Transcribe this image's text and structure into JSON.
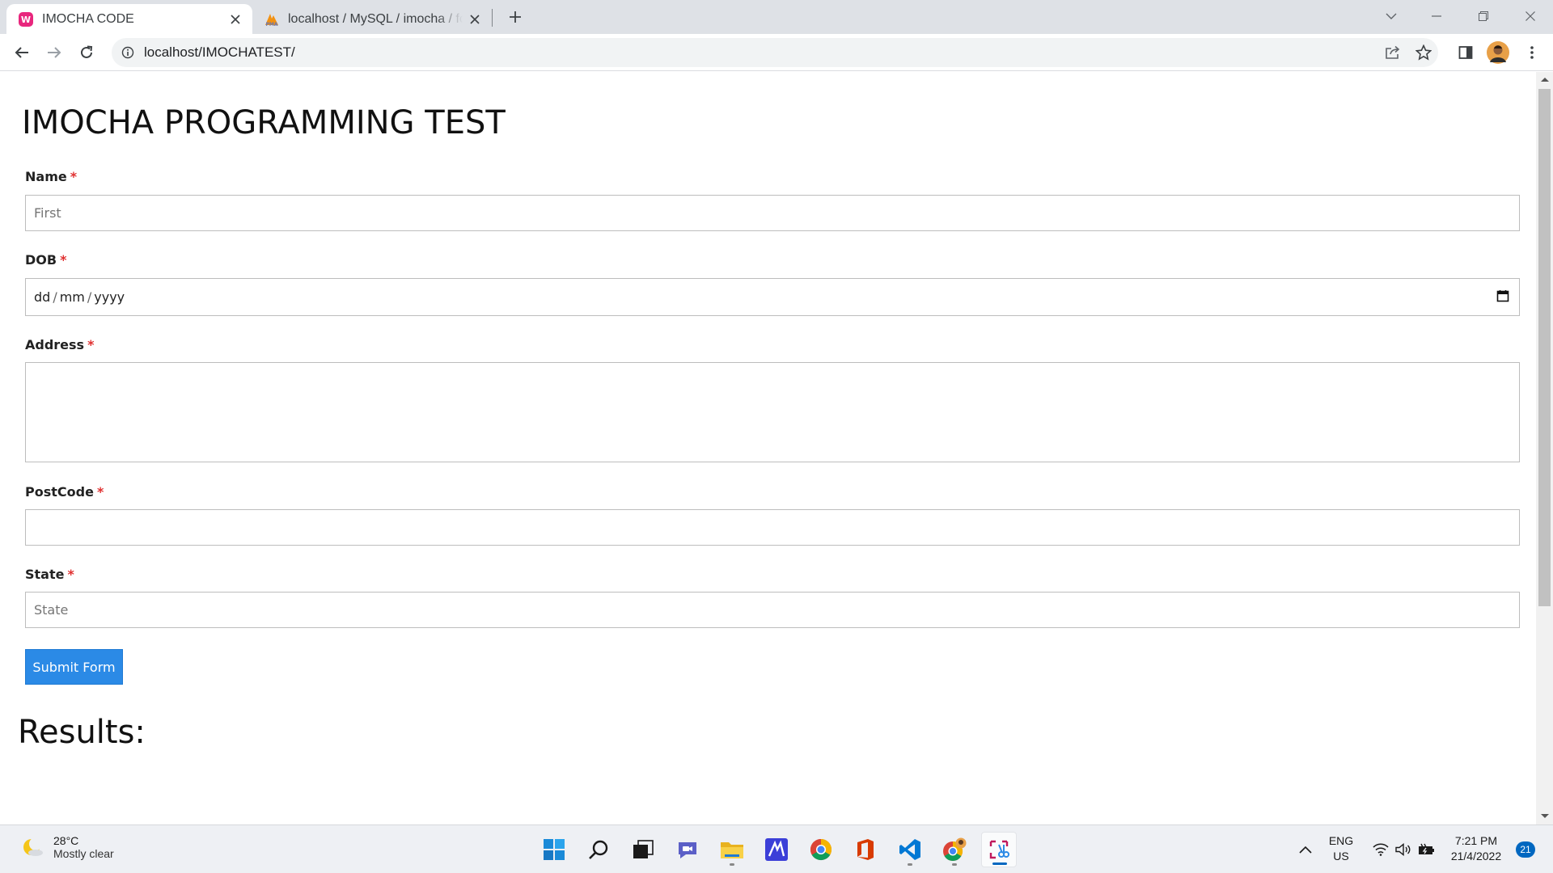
{
  "browser": {
    "tabs": [
      {
        "title": "IMOCHA CODE",
        "active": true
      },
      {
        "title": "localhost / MySQL / imocha / for",
        "active": false
      }
    ],
    "url": "localhost/IMOCHATEST/"
  },
  "page": {
    "title": "IMOCHA PROGRAMMING TEST",
    "fields": {
      "name": {
        "label": "Name",
        "required": "*",
        "placeholder": "First",
        "value": ""
      },
      "dob": {
        "label": "DOB",
        "required": "*",
        "dd": "dd",
        "mm": "mm",
        "yyyy": "yyyy",
        "sep": "/"
      },
      "address": {
        "label": "Address",
        "required": "*",
        "value": ""
      },
      "postcode": {
        "label": "PostCode",
        "required": "*",
        "value": ""
      },
      "state": {
        "label": "State",
        "required": "*",
        "placeholder": "State",
        "value": ""
      }
    },
    "submit_label": "Submit Form",
    "results_heading": "Results:"
  },
  "taskbar": {
    "weather": {
      "temp": "28°C",
      "condition": "Mostly clear"
    },
    "apps": [
      "start-icon",
      "search-icon",
      "task-view-icon",
      "teams-chat-icon",
      "file-explorer-icon",
      "mathpix-icon",
      "chrome-icon",
      "office-icon",
      "vscode-icon",
      "chrome-profile-icon",
      "snipping-tool-icon"
    ],
    "language": {
      "lang": "ENG",
      "region": "US"
    },
    "clock": {
      "time": "7:21 PM",
      "date": "21/4/2022"
    },
    "notifications": "21"
  },
  "colors": {
    "accent": "#2b8ae6",
    "required": "#e03030",
    "tab_strip": "#dee1e6"
  }
}
